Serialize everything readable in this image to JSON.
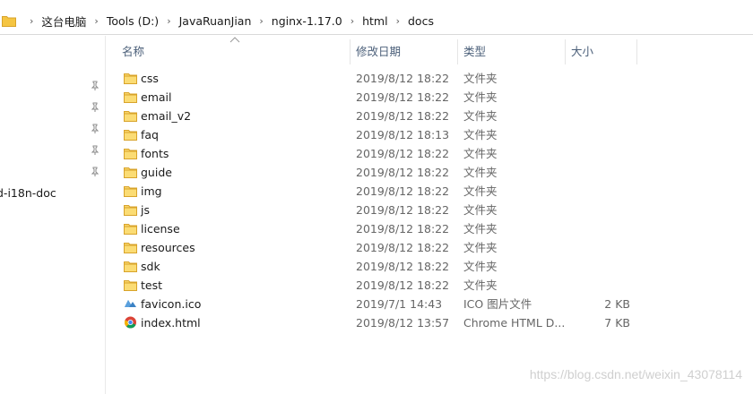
{
  "breadcrumb": [
    "这台电脑",
    "Tools (D:)",
    "JavaRuanJian",
    "nginx-1.17.0",
    "html",
    "docs"
  ],
  "nav": {
    "partial_label": "d-i18n-doc"
  },
  "columns": {
    "name": "名称",
    "date": "修改日期",
    "type": "类型",
    "size": "大小"
  },
  "files": [
    {
      "name": "css",
      "date": "2019/8/12 18:22",
      "type": "文件夹",
      "size": "",
      "icon": "folder-icon"
    },
    {
      "name": "email",
      "date": "2019/8/12 18:22",
      "type": "文件夹",
      "size": "",
      "icon": "folder-icon"
    },
    {
      "name": "email_v2",
      "date": "2019/8/12 18:22",
      "type": "文件夹",
      "size": "",
      "icon": "folder-icon"
    },
    {
      "name": "faq",
      "date": "2019/8/12 18:13",
      "type": "文件夹",
      "size": "",
      "icon": "folder-icon"
    },
    {
      "name": "fonts",
      "date": "2019/8/12 18:22",
      "type": "文件夹",
      "size": "",
      "icon": "folder-icon"
    },
    {
      "name": "guide",
      "date": "2019/8/12 18:22",
      "type": "文件夹",
      "size": "",
      "icon": "folder-icon"
    },
    {
      "name": "img",
      "date": "2019/8/12 18:22",
      "type": "文件夹",
      "size": "",
      "icon": "folder-icon"
    },
    {
      "name": "js",
      "date": "2019/8/12 18:22",
      "type": "文件夹",
      "size": "",
      "icon": "folder-icon"
    },
    {
      "name": "license",
      "date": "2019/8/12 18:22",
      "type": "文件夹",
      "size": "",
      "icon": "folder-icon"
    },
    {
      "name": "resources",
      "date": "2019/8/12 18:22",
      "type": "文件夹",
      "size": "",
      "icon": "folder-icon"
    },
    {
      "name": "sdk",
      "date": "2019/8/12 18:22",
      "type": "文件夹",
      "size": "",
      "icon": "folder-icon"
    },
    {
      "name": "test",
      "date": "2019/8/12 18:22",
      "type": "文件夹",
      "size": "",
      "icon": "folder-icon"
    },
    {
      "name": "favicon.ico",
      "date": "2019/7/1 14:43",
      "type": "ICO 图片文件",
      "size": "2 KB",
      "icon": "ico-file-icon"
    },
    {
      "name": "index.html",
      "date": "2019/8/12 13:57",
      "type": "Chrome HTML D...",
      "size": "7 KB",
      "icon": "chrome-icon"
    }
  ],
  "watermark": "https://blog.csdn.net/weixin_43078114",
  "colors": {
    "folder": "#f5c542",
    "header_text": "#4c607a"
  }
}
